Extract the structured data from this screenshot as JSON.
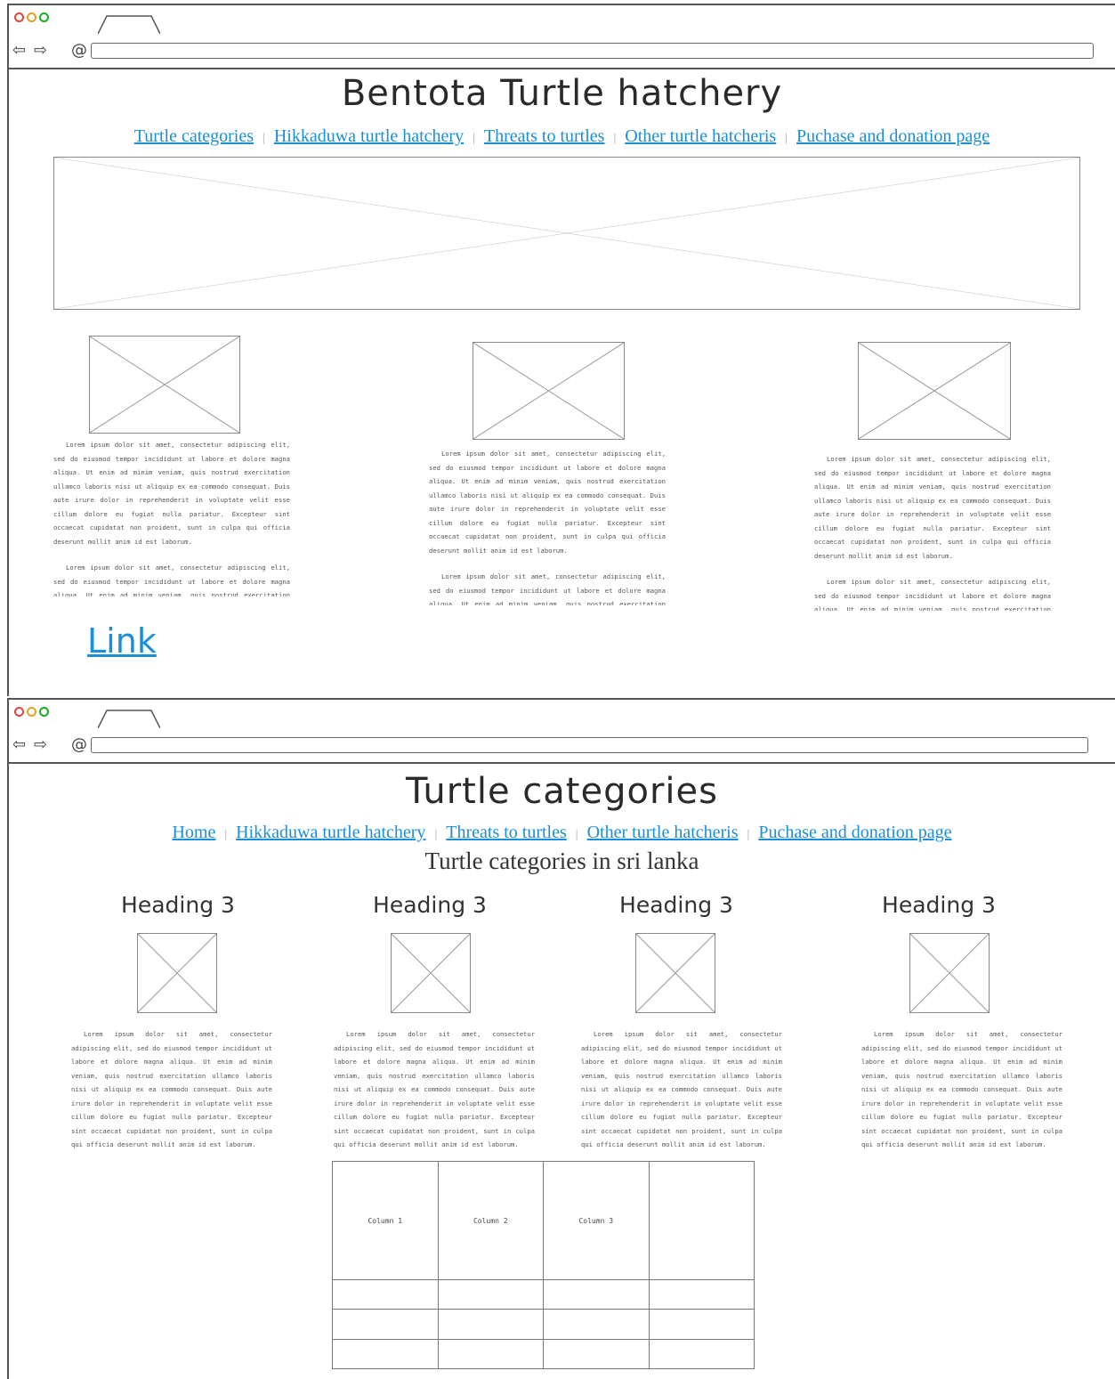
{
  "window1": {
    "title": "Bentota Turtle hatchery",
    "nav": [
      "Turtle categories",
      "Hikkaduwa turtle hatchery",
      "Threats to turtles",
      "Other turtle hatcheris",
      "Puchase and donation page"
    ],
    "paragraph": "Lorem ipsum dolor sit amet, consectetur adipiscing elit, sed do eiusmod tempor incididunt ut labore et dolore magna aliqua. Ut enim ad minim veniam, quis nostrud exercitation ullamco laboris nisi ut aliquip ex ea commodo consequat. Duis aute irure dolor in reprehenderit in voluptate velit esse cillum dolore eu fugiat nulla pariatur. Excepteur sint occaecat cupidatat non proident, sunt in culpa qui officia deserunt mollit anim id est laborum.",
    "link_label": "Link"
  },
  "window2": {
    "title": "Turtle categories",
    "nav": [
      "Home",
      "Hikkaduwa turtle hatchery",
      "Threats to turtles",
      "Other turtle hatcheris",
      "Puchase and donation page"
    ],
    "subtitle": "Turtle categories in sri lanka",
    "heading": "Heading 3",
    "paragraph": "Lorem ipsum dolor sit amet, consectetur adipiscing elit, sed do eiusmod tempor incididunt ut labore et dolore magna aliqua. Ut enim ad minim veniam, quis nostrud exercitation ullamco laboris nisi ut aliquip ex ea commodo consequat. Duis aute irure dolor in reprehenderit in voluptate velit esse cillum dolore eu fugiat nulla pariatur. Excepteur sint occaecat cupidatat non proident, sunt in culpa qui officia deserunt mollit anim id est laborum.",
    "table_headers": [
      "Column 1",
      "Column 2",
      "Column 3",
      ""
    ]
  },
  "colors": {
    "link": "#1a8fd6",
    "border": "#555555",
    "dot_red": "#e0443e",
    "dot_yellow": "#dea123",
    "dot_green": "#1aab29"
  },
  "icons": {
    "back": "back-arrow-icon",
    "forward": "forward-arrow-icon",
    "address": "at-sign-icon"
  }
}
